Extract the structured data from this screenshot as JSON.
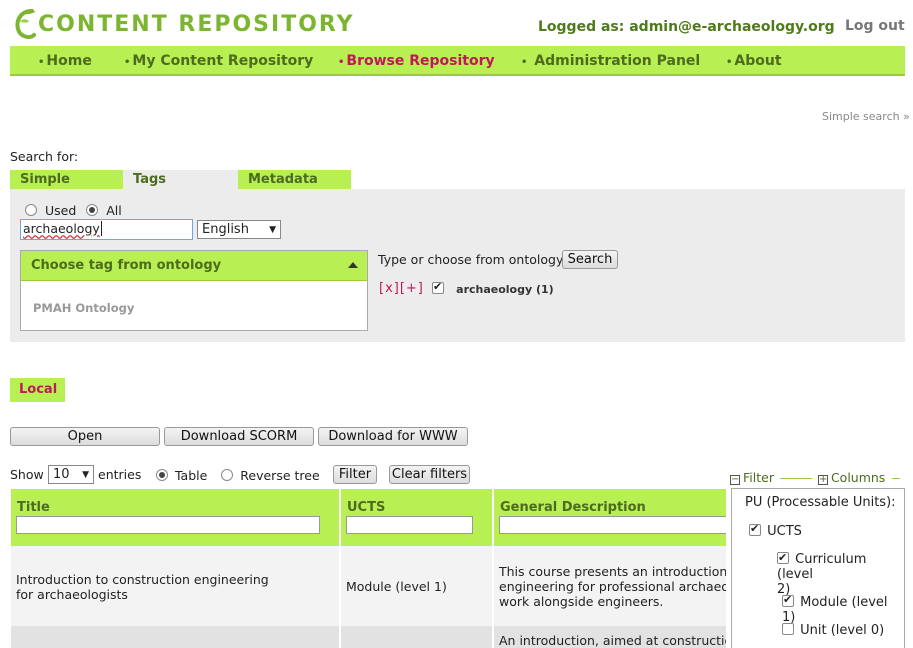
{
  "header": {
    "logo_text": "CONTENT REPOSITORY",
    "logged_as": "Logged as: admin@e-archaeology.org",
    "logout": "Log out"
  },
  "nav": [
    {
      "label": "Home"
    },
    {
      "label": "My Content Repository"
    },
    {
      "label": "Browse Repository"
    },
    {
      "label": "Administration Panel"
    },
    {
      "label": "About"
    }
  ],
  "search": {
    "simple_search_link": "Simple search »",
    "search_for": "Search for:",
    "tabs": [
      "Simple",
      "Tags",
      "Metadata"
    ],
    "radio_used": "Used",
    "radio_all": "All",
    "tag_value": "archaeology",
    "language": "English",
    "ontology_header": "Choose tag from ontology",
    "ontology_item": "PMAH Ontology",
    "type_or_choose": "Type or choose from ontology",
    "search_button": "Search",
    "xplus": "[x][+]",
    "selected_tag": "archaeology (1)"
  },
  "local": {
    "tab": "Local",
    "open_button": "Open",
    "download_scorm": "Download SCORM",
    "download_www": "Download for WWW",
    "show": "Show",
    "entries_value": "10",
    "entries": "entries",
    "table_label": "Table",
    "reverse_tree_label": "Reverse tree",
    "filter_button": "Filter",
    "clear_filters_button": "Clear filters"
  },
  "table": {
    "columns": [
      "Title",
      "UCTS",
      "General Description"
    ],
    "rows": [
      {
        "title_line1": "Introduction to construction engineering",
        "title_line2": "for archaeologists",
        "ucts": "Module (level 1)",
        "desc_line1": "This course presents an introduction to",
        "desc_line2": "engineering for professional archaeologists",
        "desc_line3": "work alongside engineers."
      },
      {
        "title_line1": "",
        "ucts": "",
        "desc_line1": "An introduction, aimed at construction"
      }
    ]
  },
  "filter_panel": {
    "filter_label": "Filter",
    "columns_label": "Columns",
    "heading": "PU (Processable Units):",
    "ucts": "UCTS",
    "curriculum_line1": "Curriculum (level",
    "curriculum_line2": "2)",
    "module": "Module (level 1)",
    "unit": "Unit (level 0)"
  },
  "colors": {
    "accent_green": "#b8ef52",
    "active_magenta": "#c0185a",
    "text_green": "#4d6b1f"
  }
}
